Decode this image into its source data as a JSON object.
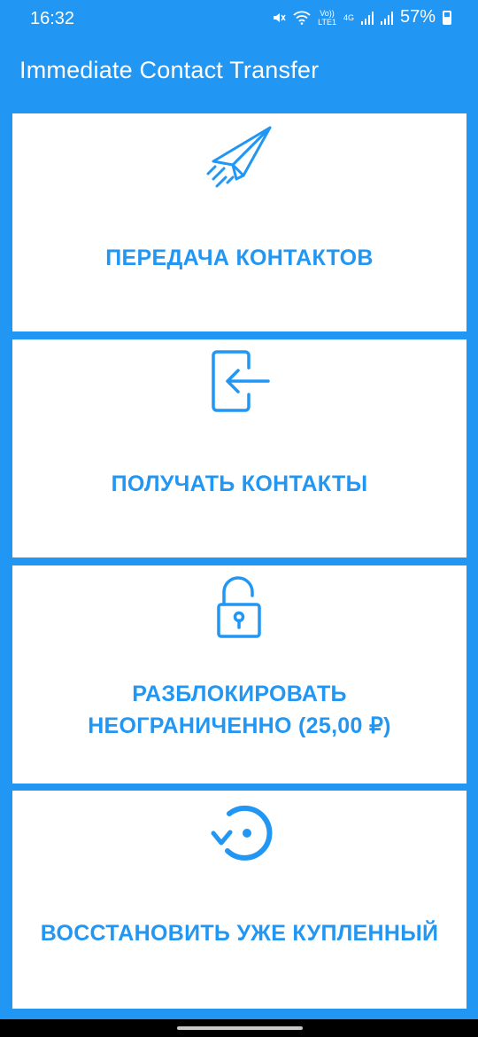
{
  "status_bar": {
    "time": "16:32",
    "volte_top": "Vo))",
    "volte_bottom": "LTE1",
    "network_type": "4G",
    "battery_percent": "57%"
  },
  "app": {
    "title": "Immediate Contact Transfer"
  },
  "actions": [
    {
      "label": "ПЕРЕДАЧА КОНТАКТОВ",
      "icon": "paper-plane-icon"
    },
    {
      "label": "ПОЛУЧАТЬ КОНТАКТЫ",
      "icon": "receive-icon"
    },
    {
      "label_line1": "РАЗБЛОКИРОВАТЬ",
      "label_line2": "НЕОГРАНИЧЕННО (25,00 ₽)",
      "icon": "unlock-icon"
    },
    {
      "label": "ВОССТАНОВИТЬ УЖЕ КУПЛЕННЫЙ",
      "icon": "restore-icon"
    }
  ],
  "colors": {
    "primary": "#2196F3",
    "card": "#FFFFFF"
  }
}
